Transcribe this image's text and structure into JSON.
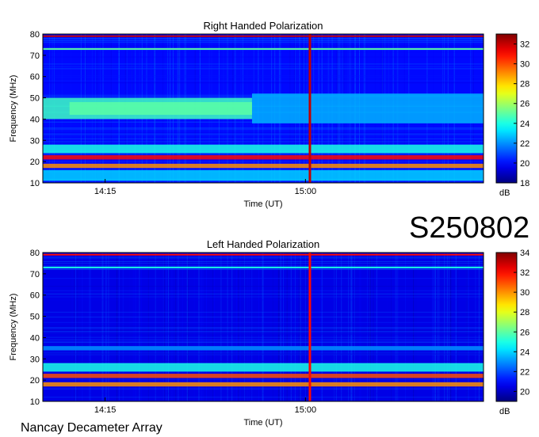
{
  "figure_id": "S250802",
  "footer": "Nancay Decameter Array",
  "chart_data": [
    {
      "type": "heatmap",
      "title": "Right Handed Polarization",
      "xlabel": "Time (UT)",
      "ylabel": "Frequency (MHz)",
      "xticks": [
        {
          "label": "14:15",
          "minutes": 855
        },
        {
          "label": "15:00",
          "minutes": 900
        }
      ],
      "xlim_minutes": [
        841,
        940
      ],
      "ylim": [
        10,
        80
      ],
      "yticks": [
        10,
        20,
        30,
        40,
        50,
        60,
        70,
        80
      ],
      "colorbar": {
        "label": "dB",
        "min": 18,
        "max": 33,
        "ticks": [
          18,
          20,
          22,
          24,
          26,
          28,
          30,
          32
        ]
      },
      "features": [
        {
          "kind": "band",
          "f_low": 42,
          "f_high": 48,
          "t_start": 847,
          "t_end": 888,
          "level": 27.5
        },
        {
          "kind": "band",
          "f_low": 40,
          "f_high": 50,
          "t_start": 841,
          "t_end": 888,
          "level": 24.5
        },
        {
          "kind": "band",
          "f_low": 38,
          "f_high": 52,
          "t_start": 888,
          "t_end": 940,
          "level": 22.5
        },
        {
          "kind": "band",
          "f_low": 21,
          "f_high": 23,
          "t_start": 841,
          "t_end": 940,
          "level": 31
        },
        {
          "kind": "band",
          "f_low": 17,
          "f_high": 19,
          "t_start": 841,
          "t_end": 940,
          "level": 29
        },
        {
          "kind": "band",
          "f_low": 24,
          "f_high": 28,
          "t_start": 841,
          "t_end": 940,
          "level": 24
        },
        {
          "kind": "band",
          "f_low": 11,
          "f_high": 16,
          "t_start": 841,
          "t_end": 940,
          "level": 23
        },
        {
          "kind": "line",
          "f": 79,
          "level": 32
        },
        {
          "kind": "line",
          "f": 73,
          "level": 25
        },
        {
          "kind": "vline",
          "t": 901,
          "level": 32
        }
      ],
      "background_level": 20
    },
    {
      "type": "heatmap",
      "title": "Left Handed Polarization",
      "xlabel": "Time (UT)",
      "ylabel": "Frequency (MHz)",
      "xticks": [
        {
          "label": "14:15",
          "minutes": 855
        },
        {
          "label": "15:00",
          "minutes": 900
        }
      ],
      "xlim_minutes": [
        841,
        940
      ],
      "ylim": [
        10,
        80
      ],
      "yticks": [
        10,
        20,
        30,
        40,
        50,
        60,
        70,
        80
      ],
      "colorbar": {
        "label": "dB",
        "min": 19,
        "max": 34,
        "ticks": [
          20,
          22,
          24,
          26,
          28,
          30,
          32,
          34
        ]
      },
      "features": [
        {
          "kind": "band",
          "f_low": 21,
          "f_high": 23,
          "t_start": 841,
          "t_end": 940,
          "level": 31
        },
        {
          "kind": "band",
          "f_low": 17,
          "f_high": 19,
          "t_start": 841,
          "t_end": 940,
          "level": 30
        },
        {
          "kind": "band",
          "f_low": 24,
          "f_high": 28,
          "t_start": 841,
          "t_end": 940,
          "level": 25
        },
        {
          "kind": "band",
          "f_low": 34,
          "f_high": 36,
          "t_start": 841,
          "t_end": 940,
          "level": 23
        },
        {
          "kind": "line",
          "f": 79,
          "level": 32
        },
        {
          "kind": "line",
          "f": 73,
          "level": 25
        },
        {
          "kind": "vline",
          "t": 901,
          "level": 32
        }
      ],
      "background_level": 20.5
    }
  ]
}
